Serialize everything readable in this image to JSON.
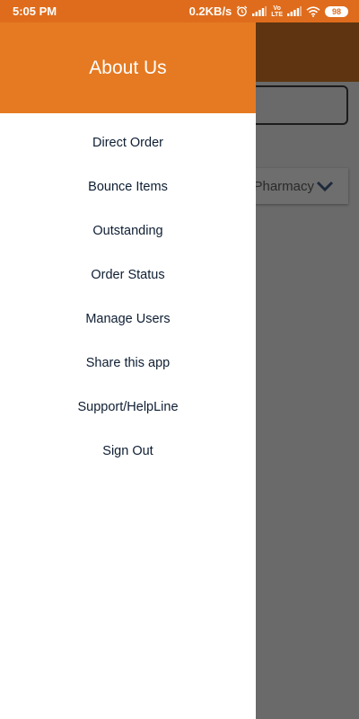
{
  "status_bar": {
    "time": "5:05 PM",
    "speed": "0.2KB/s",
    "volte": [
      "Vo",
      "LTE"
    ],
    "battery": "98",
    "icons": [
      "alarm-icon",
      "signal-icon",
      "volte-icon",
      "signal-icon",
      "wifi-icon",
      "battery-icon"
    ]
  },
  "drawer": {
    "title": "About Us",
    "items": [
      {
        "label": "Direct Order"
      },
      {
        "label": "Bounce Items"
      },
      {
        "label": "Outstanding"
      },
      {
        "label": "Order Status"
      },
      {
        "label": "Manage Users"
      },
      {
        "label": "Share this app"
      },
      {
        "label": "Support/HelpLine"
      },
      {
        "label": "Sign Out"
      }
    ]
  },
  "background": {
    "select_value": "Pharmacy",
    "select_icon": "chevron-down-icon"
  },
  "colors": {
    "status_bar": "#df6c1c",
    "drawer_header": "#e57a22",
    "menu_text": "#0e1e33",
    "scrim": "#6a6a6a"
  }
}
